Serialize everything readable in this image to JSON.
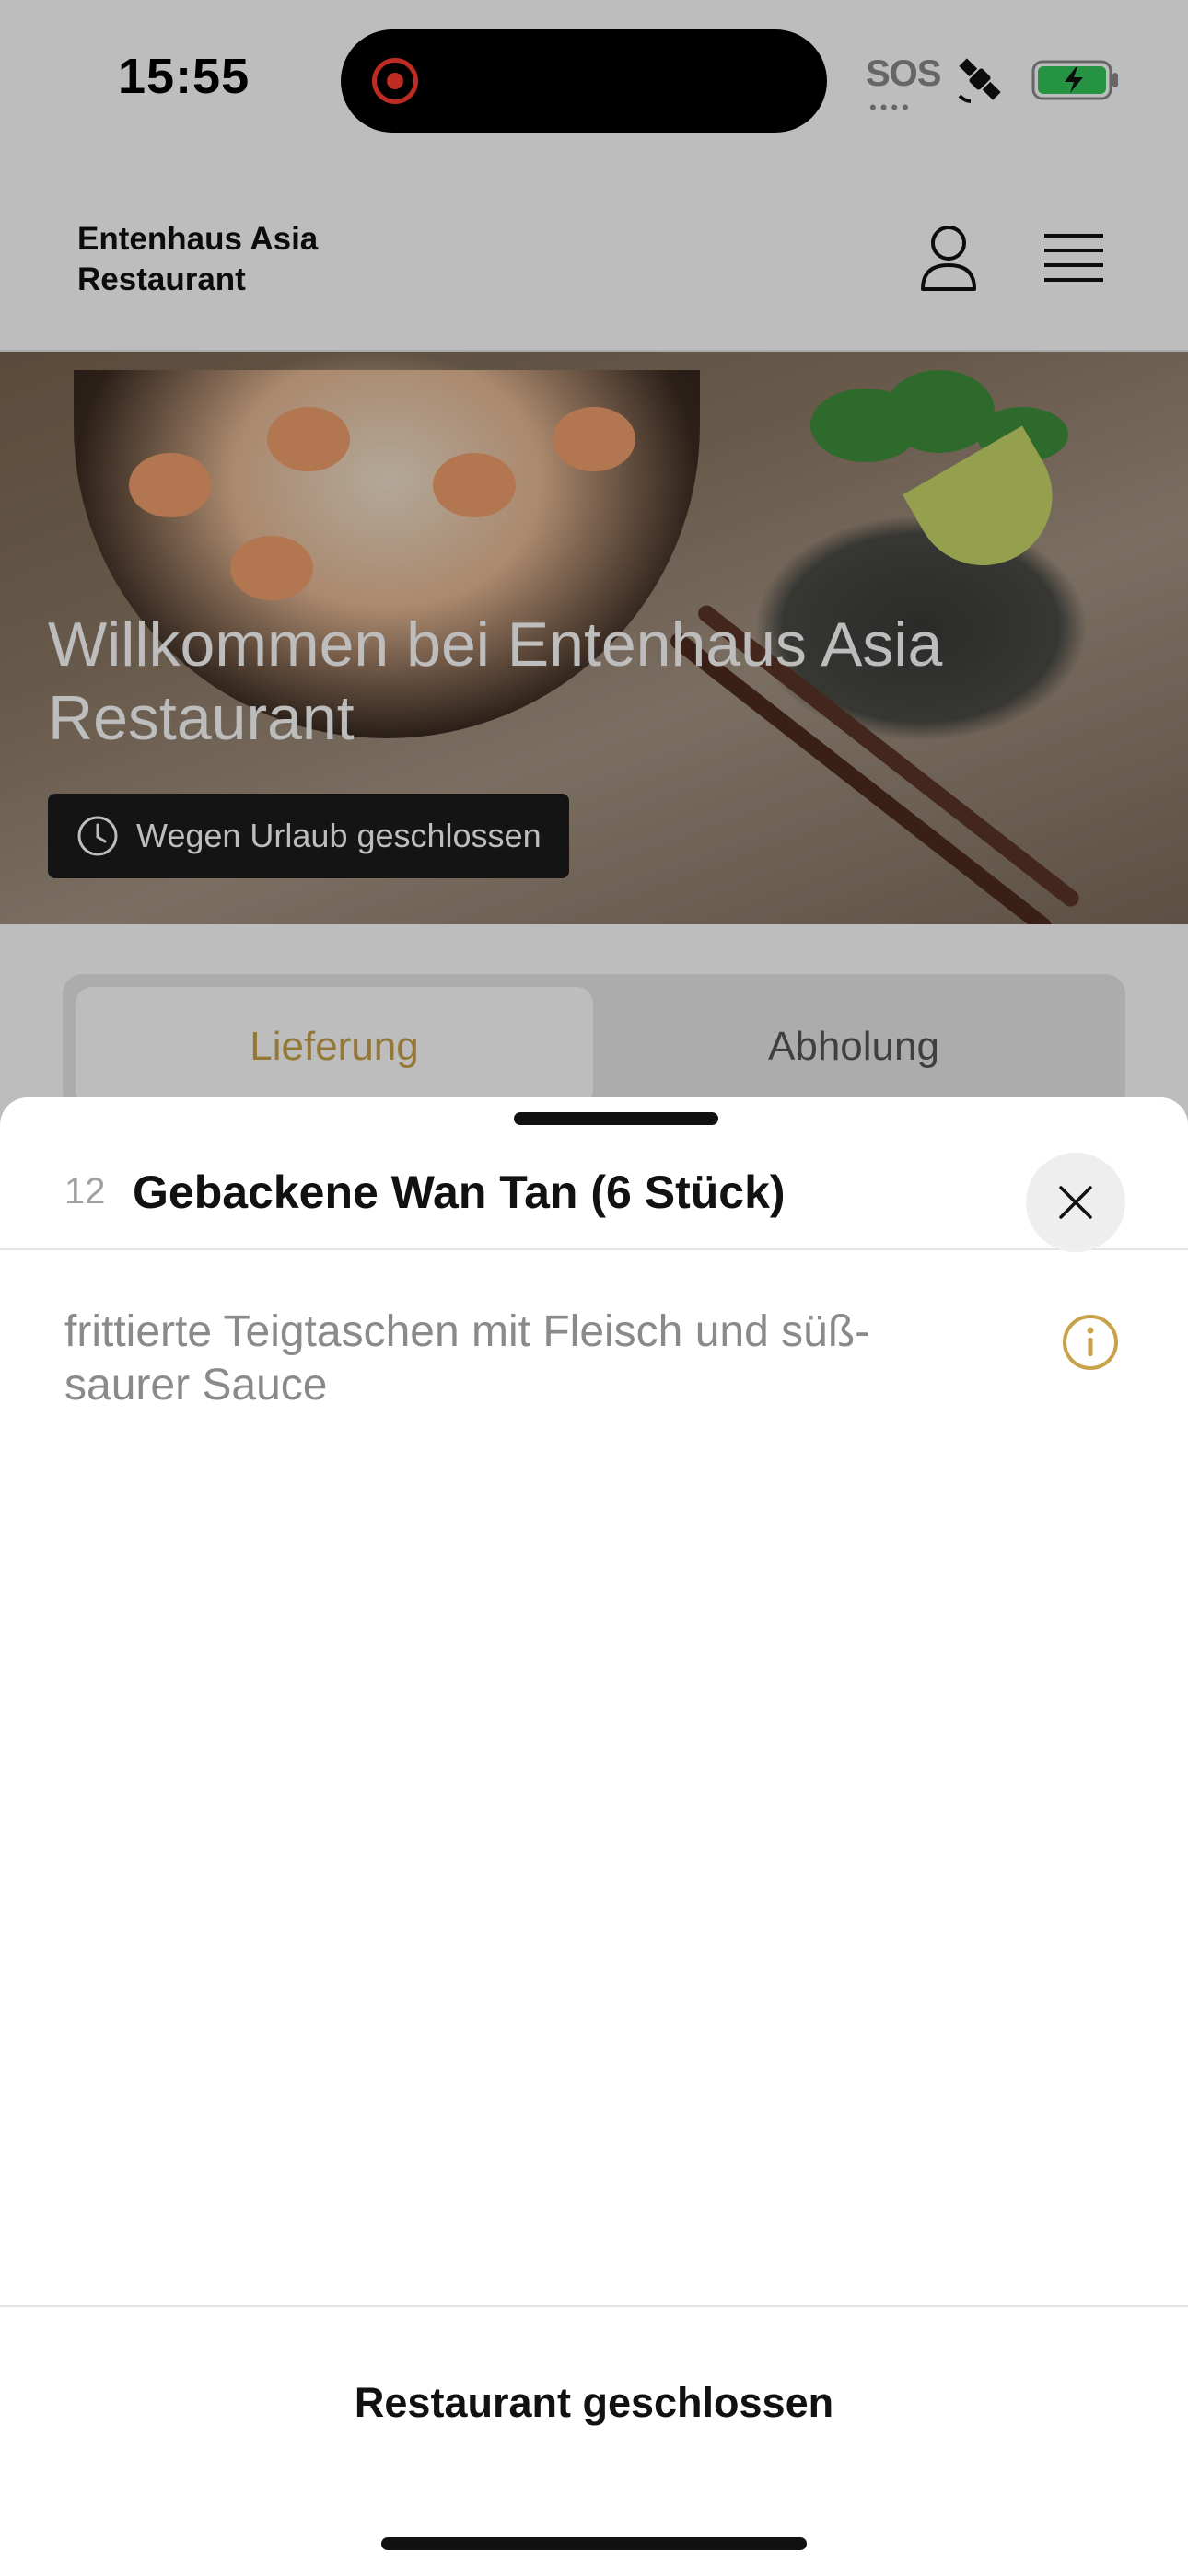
{
  "status_bar": {
    "time": "15:55",
    "sos": "SOS",
    "recording_color": "#ff3b30",
    "battery_color": "#34c759"
  },
  "header": {
    "brand": "Entenhaus Asia Restaurant",
    "icons": [
      "user-icon",
      "menu-icon"
    ]
  },
  "hero": {
    "title": "Willkommen bei Entenhaus Asia Restaurant",
    "badge": "Wegen Urlaub geschlossen",
    "badge_icon": "clock-icon"
  },
  "tabs": {
    "items": [
      {
        "label": "Lieferung",
        "active": true
      },
      {
        "label": "Abholung",
        "active": false
      }
    ],
    "accent_color": "#c8a24a"
  },
  "sheet": {
    "item_number": "12",
    "item_title": "Gebackene Wan Tan (6 Stück)",
    "description": "frittierte Teigtaschen mit Fleisch und süß-saurer Sauce",
    "info_icon": "info-icon",
    "close_icon": "close-icon",
    "footer_label": "Restaurant geschlossen"
  }
}
